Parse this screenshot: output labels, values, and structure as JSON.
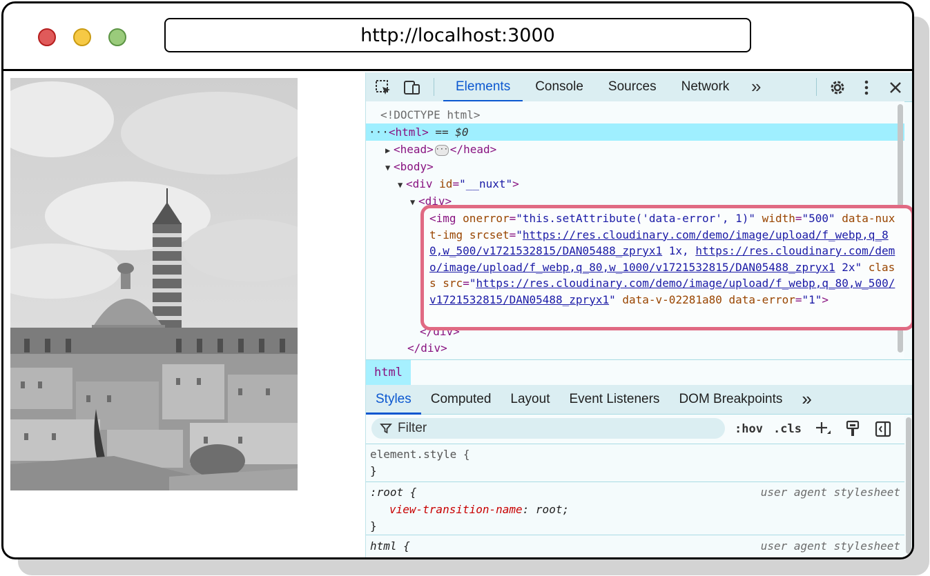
{
  "browser": {
    "url": "http://localhost:3000",
    "traffic_lights": [
      "close",
      "minimize",
      "maximize"
    ]
  },
  "devtools": {
    "tabs": [
      {
        "label": "Elements",
        "active": true
      },
      {
        "label": "Console"
      },
      {
        "label": "Sources"
      },
      {
        "label": "Network"
      }
    ],
    "more_tabs": "»",
    "dom": {
      "doctype": "<!DOCTYPE html>",
      "html_line": "<html>",
      "html_suffix": " == $0",
      "head_open": "<head>",
      "head_close": "</head>",
      "body_open": "<body>",
      "div_nuxt_tag": "<div",
      "div_nuxt_attr": "id",
      "div_nuxt_val": "\"__nuxt\"",
      "div_open": "<div>",
      "div_close_inner": "</div>",
      "div_close_outer": "</div>",
      "img": {
        "tag_open": "<img",
        "onerror_attr": "onerror",
        "onerror_val": "\"this.setAttribute('data-error', 1)\"",
        "width_attr": "width",
        "width_val": "\"500\"",
        "nuxt_attr": "data-nuxt-img",
        "srcset_attr": "srcset",
        "srcset_link1": "https://res.cloudinary.com/demo/image/upload/f_webp,q_80,w_500/v1721532815/DAN05488_zpryx1",
        "srcset_1x": " 1x, ",
        "srcset_link2": "https://res.cloudinary.com/demo/image/upload/f_webp,q_80,w_1000/v1721532815/DAN05488_zpryx1",
        "srcset_2x": " 2x\"",
        "class_attr": "class",
        "src_attr": "src",
        "src_link": "https://res.cloudinary.com/demo/image/upload/f_webp,q_80,w_500/v1721532815/DAN05488_zpryx1",
        "datav_attr": "data-v-02281a80",
        "error_attr": "data-error",
        "error_val": "\"1\"",
        "tag_end": ">"
      }
    },
    "breadcrumb": "html",
    "subtabs": [
      {
        "label": "Styles",
        "active": true
      },
      {
        "label": "Computed"
      },
      {
        "label": "Layout"
      },
      {
        "label": "Event Listeners"
      },
      {
        "label": "DOM Breakpoints"
      }
    ],
    "filter_placeholder": "Filter",
    "hov": ":hov",
    "cls": ".cls",
    "styles": {
      "element_style": "element.style {",
      "close_brace": "}",
      "root_selector": ":root {",
      "root_prop": "view-transition-name",
      "root_value": "root;",
      "ua_label": "user agent stylesheet",
      "html_selector": "html {"
    }
  }
}
